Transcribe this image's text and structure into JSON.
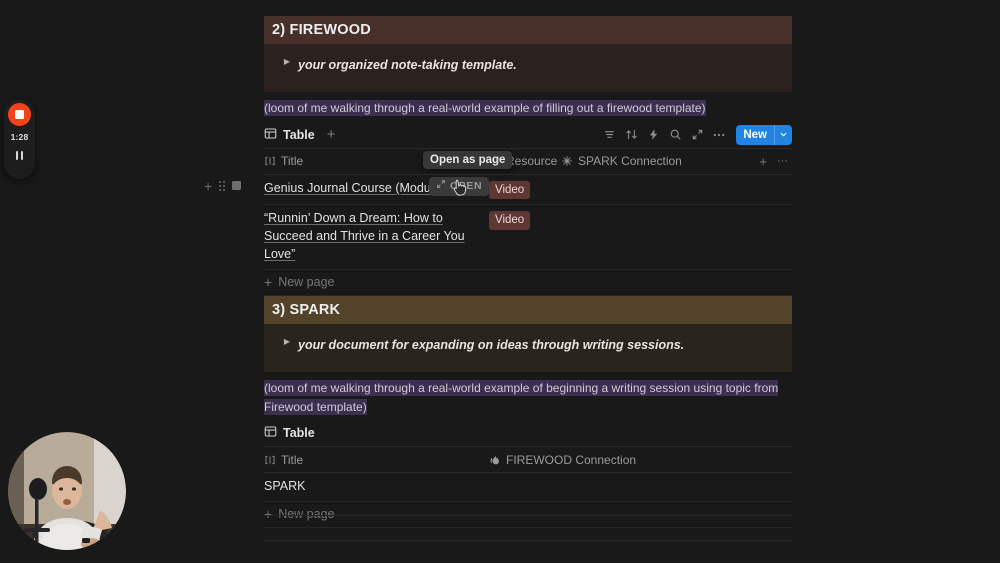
{
  "sections": [
    {
      "banner": "2) FIREWOOD",
      "callout": "your organized note-taking template.",
      "loom": "(loom of me walking through a real-world example of filling out a firewood template)"
    },
    {
      "banner": "3) SPARK",
      "callout": "your document for expanding on ideas through writing sessions.",
      "loom": "(loom of me walking through a real-world example of beginning a writing session using topic from Firewood template)"
    }
  ],
  "firewood_db": {
    "view_label": "Table",
    "add_view_label": "+",
    "tools": {
      "filter": "filter-icon",
      "sort": "sort-icon",
      "automation": "lightning-icon",
      "search": "search-icon",
      "expand": "expand-icon",
      "more": "more-icon",
      "new_label": "New",
      "new_chevron": "chevron-down-icon"
    },
    "columns": [
      {
        "label": "Title",
        "icon": "title-icon"
      },
      {
        "label": "Resource",
        "icon": "media-play-icon"
      },
      {
        "label": "SPARK Connection",
        "icon": "sparkle-icon"
      }
    ],
    "header_actions": {
      "add_column": "+",
      "more": "···"
    },
    "rows": [
      {
        "title": "Genius Journal Course (Module 1",
        "resource": "Video"
      },
      {
        "title": "“Runnin’ Down a Dream: How to Succeed and Thrive in a Career You Love”",
        "resource": "Video"
      }
    ],
    "new_page_label": "New page"
  },
  "spark_db": {
    "view_label": "Table",
    "columns": [
      {
        "label": "Title",
        "icon": "title-icon"
      },
      {
        "label": "FIREWOOD Connection",
        "icon": "fire-icon"
      }
    ],
    "rows": [
      {
        "title": "SPARK",
        "connection": ""
      }
    ],
    "new_page_label": "New page"
  },
  "overlays": {
    "tooltip": "Open as page",
    "open_pill_label": "OPEN",
    "open_pill_icon": "expand-arrows-icon",
    "cursor": "pointer-cursor"
  },
  "recorder": {
    "stop_icon": "stop-square-icon",
    "elapsed": "1:28",
    "pause_icon": "pause-icon"
  },
  "webcam": {
    "label": "webcam-bubble"
  },
  "colors": {
    "page_bg": "#191919",
    "firewood_banner": "#47302a",
    "spark_banner": "#53432a",
    "callout_firewood": "#2b211e",
    "callout_spark": "#2a251c",
    "loom_highlight": "#3b3050",
    "tag_bg": "#5c3733",
    "accent_blue": "#2383e2",
    "record_red": "#f4441e"
  }
}
